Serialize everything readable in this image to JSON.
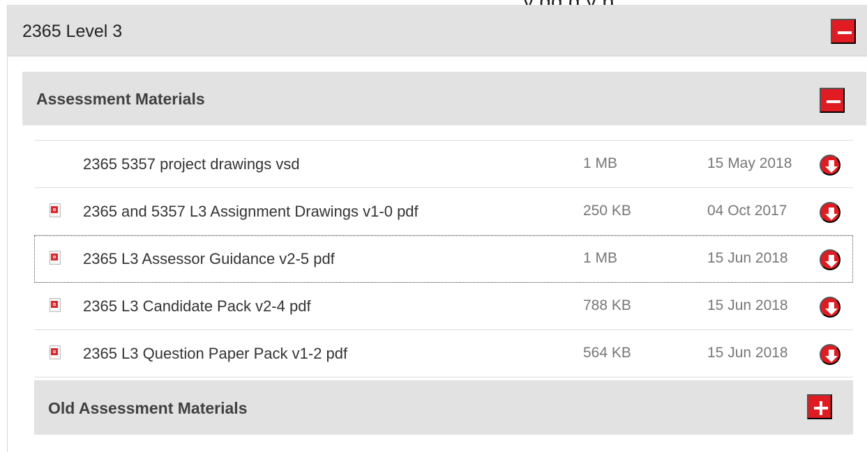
{
  "top_partial_text": "y   gg  g  y p",
  "section": {
    "title": "2365 Level 3",
    "toggle_label": "collapse"
  },
  "assessment": {
    "title": "Assessment Materials",
    "toggle_label": "collapse",
    "files": [
      {
        "name": "2365 5357 project drawings vsd",
        "size": "1 MB",
        "date": "15 May 2018",
        "icon": "none",
        "download_icon": "download-icon"
      },
      {
        "name": "2365 and 5357 L3 Assignment Drawings v1-0 pdf",
        "size": "250 KB",
        "date": "04 Oct 2017",
        "icon": "pdf-file-icon",
        "download_icon": "download-icon"
      },
      {
        "name": "2365 L3 Assessor Guidance v2-5 pdf",
        "size": "1 MB",
        "date": "15 Jun 2018",
        "icon": "pdf-file-icon",
        "download_icon": "download-icon"
      },
      {
        "name": "2365 L3 Candidate Pack v2-4 pdf",
        "size": "788 KB",
        "date": "15 Jun 2018",
        "icon": "pdf-file-icon",
        "download_icon": "download-icon"
      },
      {
        "name": "2365 L3 Question Paper Pack v1-2 pdf",
        "size": "564 KB",
        "date": "15 Jun 2018",
        "icon": "pdf-file-icon",
        "download_icon": "download-icon"
      }
    ]
  },
  "old_assessment": {
    "title": "Old Assessment Materials",
    "toggle_label": "expand"
  },
  "colors": {
    "accent": "#e11b22",
    "header_background": "#e2e2e2",
    "row_border": "#dddddd",
    "text": "#333333",
    "muted_text": "#777777"
  }
}
